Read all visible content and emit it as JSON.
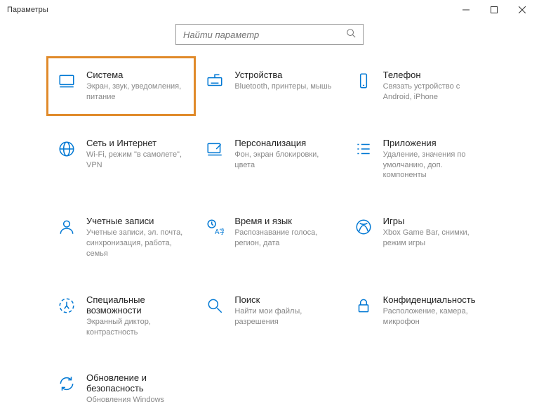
{
  "window": {
    "title": "Параметры"
  },
  "search": {
    "placeholder": "Найти параметр"
  },
  "tiles": {
    "system": {
      "title": "Система",
      "desc": "Экран, звук, уведомления, питание"
    },
    "devices": {
      "title": "Устройства",
      "desc": "Bluetooth, принтеры, мышь"
    },
    "phone": {
      "title": "Телефон",
      "desc": "Связать устройство с Android, iPhone"
    },
    "network": {
      "title": "Сеть и Интернет",
      "desc": "Wi-Fi, режим \"в самолете\", VPN"
    },
    "personalize": {
      "title": "Персонализация",
      "desc": "Фон, экран блокировки, цвета"
    },
    "apps": {
      "title": "Приложения",
      "desc": "Удаление, значения по умолчанию, доп. компоненты"
    },
    "accounts": {
      "title": "Учетные записи",
      "desc": "Учетные записи, эл. почта, синхронизация, работа, семья"
    },
    "time": {
      "title": "Время и язык",
      "desc": "Распознавание голоса, регион, дата"
    },
    "gaming": {
      "title": "Игры",
      "desc": "Xbox Game Bar, снимки, режим игры"
    },
    "ease": {
      "title": "Специальные возможности",
      "desc": "Экранный диктор, контрастность"
    },
    "searchcat": {
      "title": "Поиск",
      "desc": "Найти мои файлы, разрешения"
    },
    "privacy": {
      "title": "Конфиденциальность",
      "desc": "Расположение, камера, микрофон"
    },
    "update": {
      "title": "Обновление и безопасность",
      "desc": "Обновления Windows"
    }
  }
}
